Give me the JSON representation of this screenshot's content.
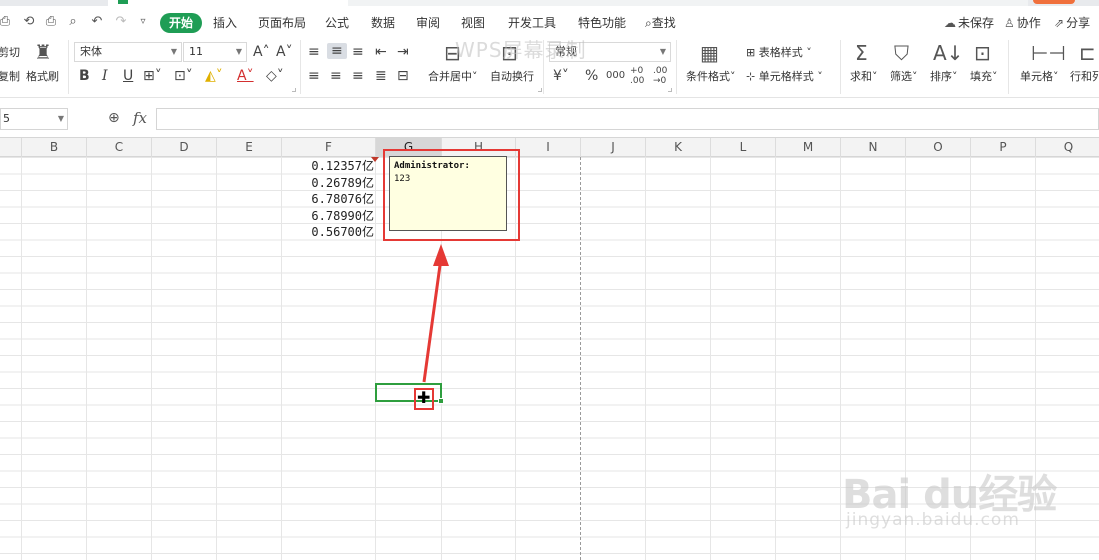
{
  "menu": {
    "tabs": [
      "开始",
      "插入",
      "页面布局",
      "公式",
      "数据",
      "审阅",
      "视图",
      "开发工具",
      "特色功能"
    ],
    "search": "查找",
    "unsaved": "未保存",
    "collab": "协作",
    "share": "分享"
  },
  "ribbon": {
    "cut": "剪切",
    "copy": "复制",
    "format_painter": "格式刷",
    "font_name": "宋体",
    "font_size": "11",
    "bold": "B",
    "italic": "I",
    "underline": "U",
    "merge_center": "合并居中",
    "wrap_text": "自动换行",
    "number_format": "常规",
    "currency": "¥",
    "percent": "%",
    "thousands": "000",
    "dec_inc": "+0 .00",
    "dec_dec": ".00 →0",
    "conditional_format": "条件格式",
    "table_style": "表格样式",
    "cell_style": "单元格样式",
    "sum": "求和",
    "filter": "筛选",
    "sort": "排序",
    "fill": "填充",
    "cells": "单元格",
    "rows_cols": "行和列"
  },
  "formula_bar": {
    "name_box": "5",
    "fx": "fx"
  },
  "columns": [
    "B",
    "C",
    "D",
    "E",
    "F",
    "G",
    "H",
    "I",
    "J",
    "K",
    "L",
    "M",
    "N",
    "O",
    "P",
    "Q"
  ],
  "selected_column": "G",
  "cells_F": [
    "0.12357亿",
    "0.26789亿",
    "6.78076亿",
    "6.78990亿",
    "0.56700亿"
  ],
  "comment": {
    "author": "Administrator:",
    "text": "123"
  },
  "watermarks": {
    "wps": "WPS屏幕录制",
    "baidu": "Bai du经验",
    "url": "jingyan.baidu.com"
  },
  "colors": {
    "accent": "#1f9d55",
    "highlight": "#e53935",
    "comment_bg": "#ffffe1",
    "active_cell": "#2e9e3e"
  }
}
